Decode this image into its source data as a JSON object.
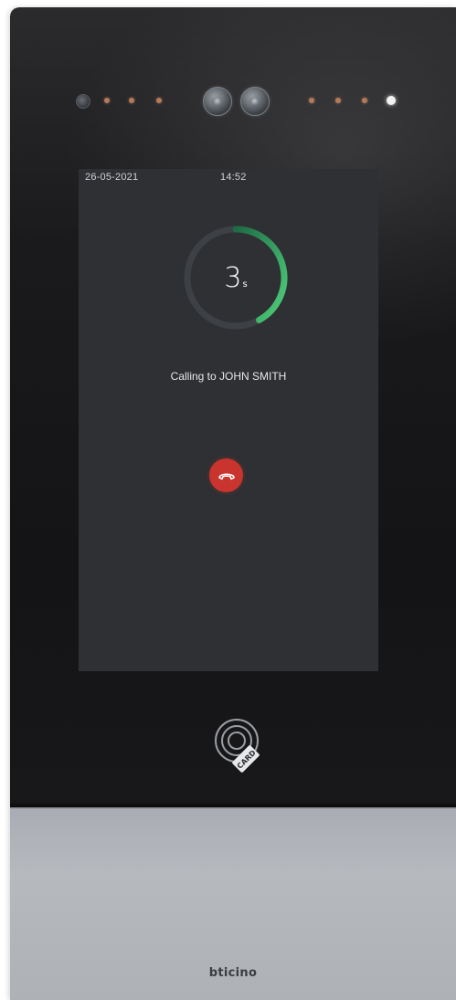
{
  "device": {
    "brand": "bticino",
    "card_reader": {
      "icon": "card-reader-icon",
      "label": "CARD"
    }
  },
  "screen": {
    "date": "26-05-2021",
    "time": "14:52",
    "countdown": {
      "value": "3",
      "unit": "s",
      "progress": 0.42
    },
    "call_status": "Calling to JOHN SMITH",
    "hangup_icon": "hangup-phone-icon"
  },
  "colors": {
    "progress_start": "#1f6b45",
    "progress_end": "#4fd07a",
    "ring_track": "#3d4045",
    "hangup": "#c9342e",
    "screen_bg": "#2e3034"
  }
}
